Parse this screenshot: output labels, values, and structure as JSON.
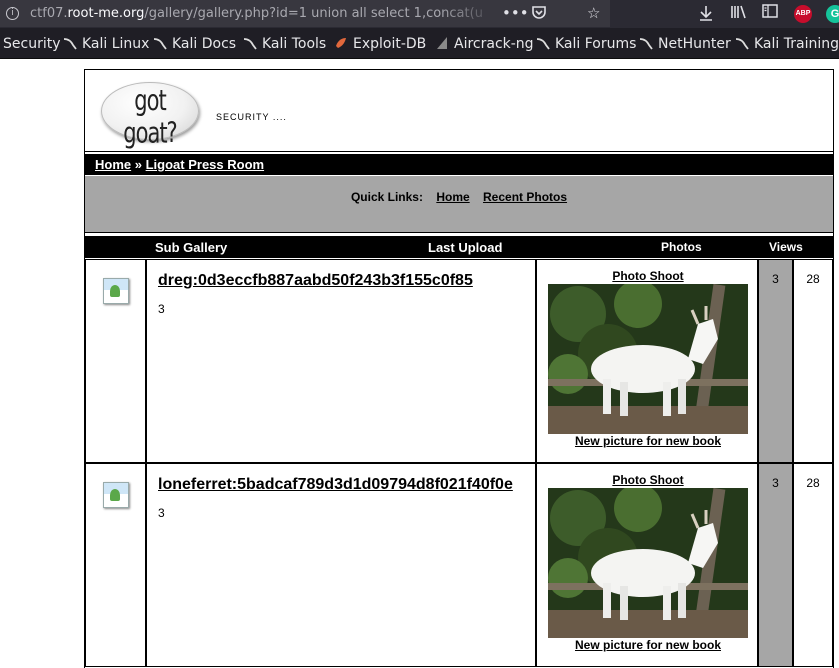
{
  "browser": {
    "url_prefix": "ctf07.",
    "url_domain": "root-me.org",
    "url_rest": "/gallery/gallery.php?id=1 union all select 1,concat(u",
    "bookmarks": [
      {
        "label": "Security",
        "icon": "none"
      },
      {
        "label": "Kali Linux",
        "icon": "kali-dragon-icon"
      },
      {
        "label": "Kali Docs",
        "icon": "kali-dragon-icon"
      },
      {
        "label": "Kali Tools",
        "icon": "kali-dragon-icon"
      },
      {
        "label": "Exploit-DB",
        "icon": "exploit-db-icon"
      },
      {
        "label": "Aircrack-ng",
        "icon": "aircrack-icon"
      },
      {
        "label": "Kali Forums",
        "icon": "kali-dragon-icon"
      },
      {
        "label": "NetHunter",
        "icon": "kali-dragon-icon"
      },
      {
        "label": "Kali Training",
        "icon": "kali-dragon-icon"
      }
    ],
    "abp_label": "ABP",
    "grammarly_label": "G"
  },
  "site": {
    "logo_text": "got goat?",
    "tagline": "SECURITY ....",
    "breadcrumb_home": "Home",
    "breadcrumb_sep": "»",
    "breadcrumb_current": "Ligoat Press Room",
    "quick_links_label": "Quick Links:",
    "quick_links": [
      "Home",
      "Recent Photos"
    ]
  },
  "table": {
    "headers": {
      "sub_gallery": "Sub Gallery",
      "last_upload": "Last Upload",
      "photos": "Photos",
      "views": "Views"
    },
    "rows": [
      {
        "name": "dreg:0d3eccfb887aabd50f243b3f155c0f85",
        "count": "3",
        "photo_title": "Photo Shoot",
        "photo_caption": "New picture for new book",
        "photos": "3",
        "views": "28"
      },
      {
        "name": "loneferret:5badcaf789d3d1d09794d8f021f40f0e",
        "count": "3",
        "photo_title": "Photo Shoot",
        "photo_caption": "New picture for new book",
        "photos": "3",
        "views": "28"
      }
    ]
  },
  "colors": {
    "header_bg": "#000000",
    "quick_links_bg": "#a6a6a6",
    "photos_col_bg": "#a6a6a6"
  }
}
